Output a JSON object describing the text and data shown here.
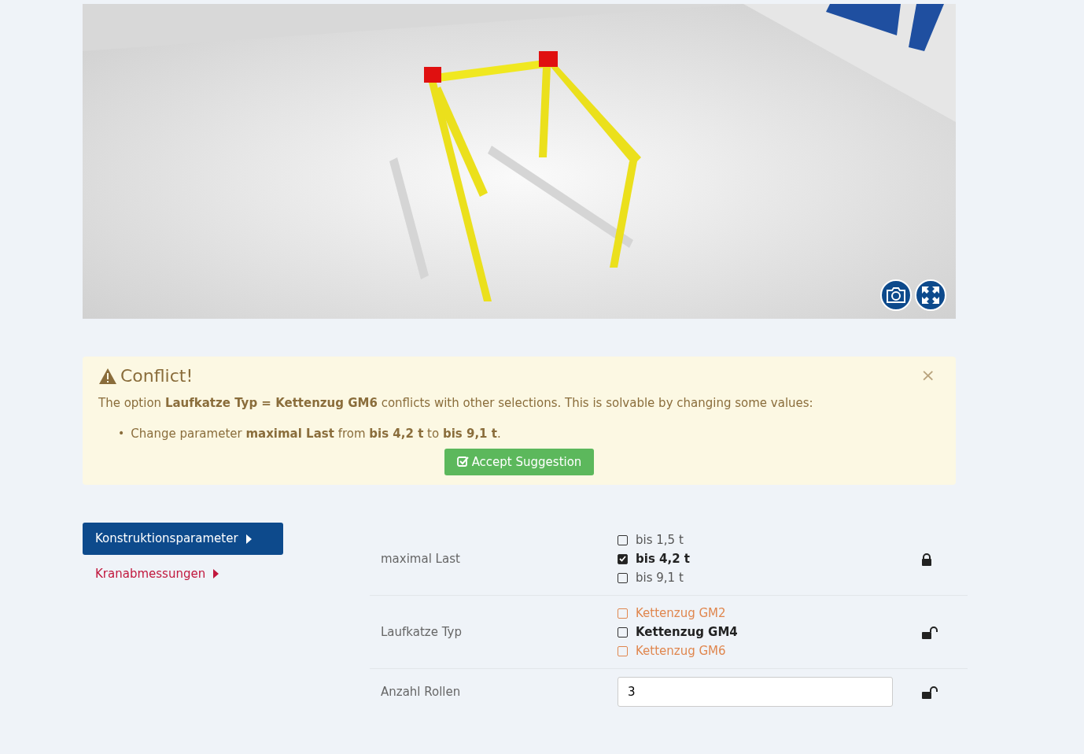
{
  "viewer": {
    "kind": "picture",
    "buttons": [
      {
        "kind": "camera"
      },
      {
        "kind": "fullscreen"
      }
    ]
  },
  "alert": {
    "title": "Conflict!",
    "message": "The option **Laufkatze Typ = Kettenzug GM6** conflicts with other selections. This is solvable by changing some values:",
    "suggestions": [
      {
        "bullet": "•",
        "text": "Change parameter **maximal Last** from **bis 4,2 t** to **bis 9,1 t**."
      }
    ],
    "button": "Accept Suggestion",
    "close": "×"
  },
  "nav": [
    {
      "label": "Konstruktionsparameter",
      "selected": true
    },
    {
      "label": "Kranabmessungen",
      "selected": false
    }
  ],
  "parameters": [
    {
      "label": "maximal Last",
      "kind": "options",
      "locked": true,
      "options": [
        {
          "label": "bis 1,5 t",
          "checked": false,
          "selected": false,
          "conflict": false
        },
        {
          "label": "bis 4,2 t",
          "checked": true,
          "selected": true,
          "conflict": false
        },
        {
          "label": "bis 9,1 t",
          "checked": false,
          "selected": false,
          "conflict": false
        }
      ]
    },
    {
      "label": "Laufkatze Typ",
      "kind": "options",
      "locked": false,
      "options": [
        {
          "label": "Kettenzug GM2",
          "checked": false,
          "selected": false,
          "conflict": true
        },
        {
          "label": "Kettenzug GM4",
          "checked": false,
          "selected": true,
          "conflict": false
        },
        {
          "label": "Kettenzug GM6",
          "checked": false,
          "selected": false,
          "conflict": true
        }
      ]
    },
    {
      "label": "Anzahl Rollen",
      "kind": "input",
      "locked": false,
      "value": "3"
    }
  ]
}
